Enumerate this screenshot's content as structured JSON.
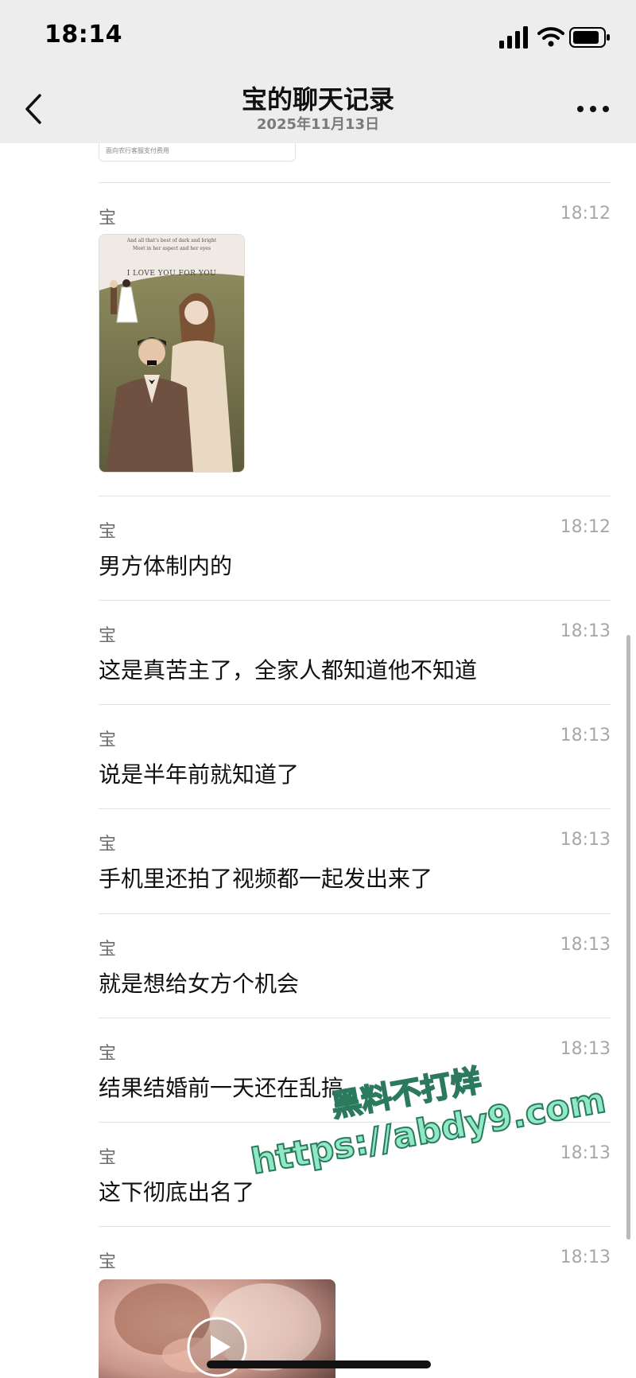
{
  "status_bar": {
    "time": "18:14"
  },
  "header": {
    "title": "宝的聊天记录",
    "subtitle": "2025年11月13日"
  },
  "previous_card": {
    "caption": "面向农行客服支付费用"
  },
  "photo": {
    "caption_line1": "And all that's best of dark and bright",
    "caption_line2": "Meet in her aspect and her eyes",
    "caption_line3": "I LOVE YOU FOR YOU"
  },
  "messages": [
    {
      "sender": "宝",
      "time": "18:12",
      "type": "image"
    },
    {
      "sender": "宝",
      "time": "18:12",
      "text": "男方体制内的"
    },
    {
      "sender": "宝",
      "time": "18:13",
      "text": "这是真苦主了，全家人都知道他不知道"
    },
    {
      "sender": "宝",
      "time": "18:13",
      "text": "说是半年前就知道了"
    },
    {
      "sender": "宝",
      "time": "18:13",
      "text": "手机里还拍了视频都一起发出来了"
    },
    {
      "sender": "宝",
      "time": "18:13",
      "text": "就是想给女方个机会"
    },
    {
      "sender": "宝",
      "time": "18:13",
      "text": "结果结婚前一天还在乱搞"
    },
    {
      "sender": "宝",
      "time": "18:13",
      "text": "这下彻底出名了"
    },
    {
      "sender": "宝",
      "time": "18:13",
      "type": "video"
    }
  ],
  "watermark": {
    "line1": "黑料不打烊",
    "line2": "https://abdy9.com"
  },
  "colors": {
    "header_bg": "#ededed",
    "watermark": "#8fe8c6"
  }
}
